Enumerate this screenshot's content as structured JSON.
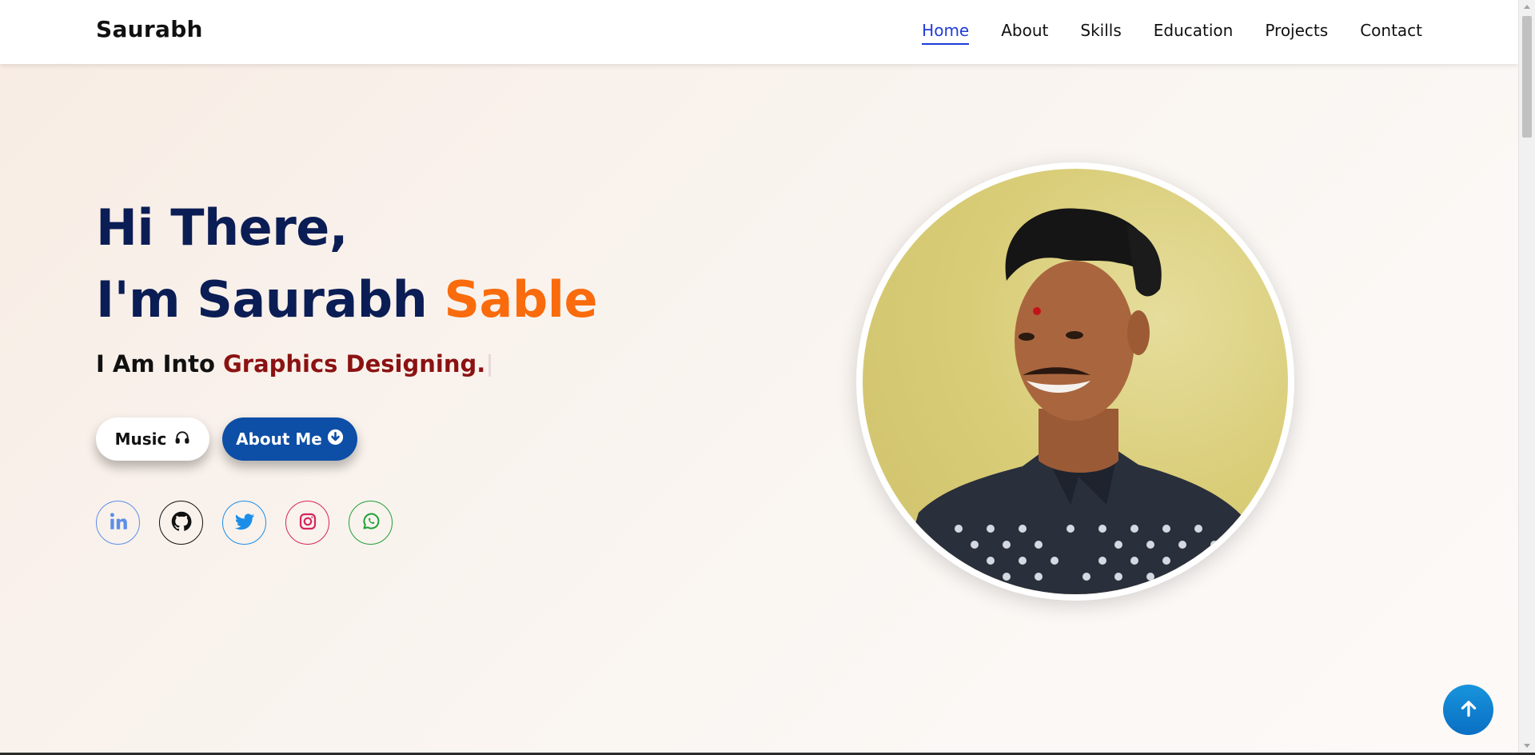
{
  "header": {
    "brand": "Saurabh",
    "nav": [
      {
        "label": "Home",
        "active": true
      },
      {
        "label": "About"
      },
      {
        "label": "Skills"
      },
      {
        "label": "Education"
      },
      {
        "label": "Projects"
      },
      {
        "label": "Contact"
      }
    ]
  },
  "hero": {
    "greeting": "Hi There,",
    "name_prefix": "I'm Saurabh ",
    "name_accent": "Sable",
    "typed_prefix": "I Am Into ",
    "typed_text": "Graphics Designing.",
    "buttons": {
      "music": {
        "label": "Music",
        "icon": "headphones-icon"
      },
      "about": {
        "label": "About Me",
        "icon": "arrow-circle-down-icon"
      }
    },
    "socials": [
      {
        "name": "linkedin-icon",
        "color": "#5c8fe8"
      },
      {
        "name": "github-icon",
        "color": "#111111"
      },
      {
        "name": "twitter-icon",
        "color": "#1d8ee8"
      },
      {
        "name": "instagram-icon",
        "color": "#d6245f"
      },
      {
        "name": "whatsapp-icon",
        "color": "#1fa135"
      }
    ],
    "portrait_icon": "profile-photo"
  },
  "scroll_top": {
    "icon": "arrow-up-icon"
  },
  "colors": {
    "navy": "#0b1d55",
    "orange": "#f96b0c",
    "maroon": "#8b1212",
    "nav_active": "#1f3cd8",
    "button_blue": "#0d4ea6"
  }
}
